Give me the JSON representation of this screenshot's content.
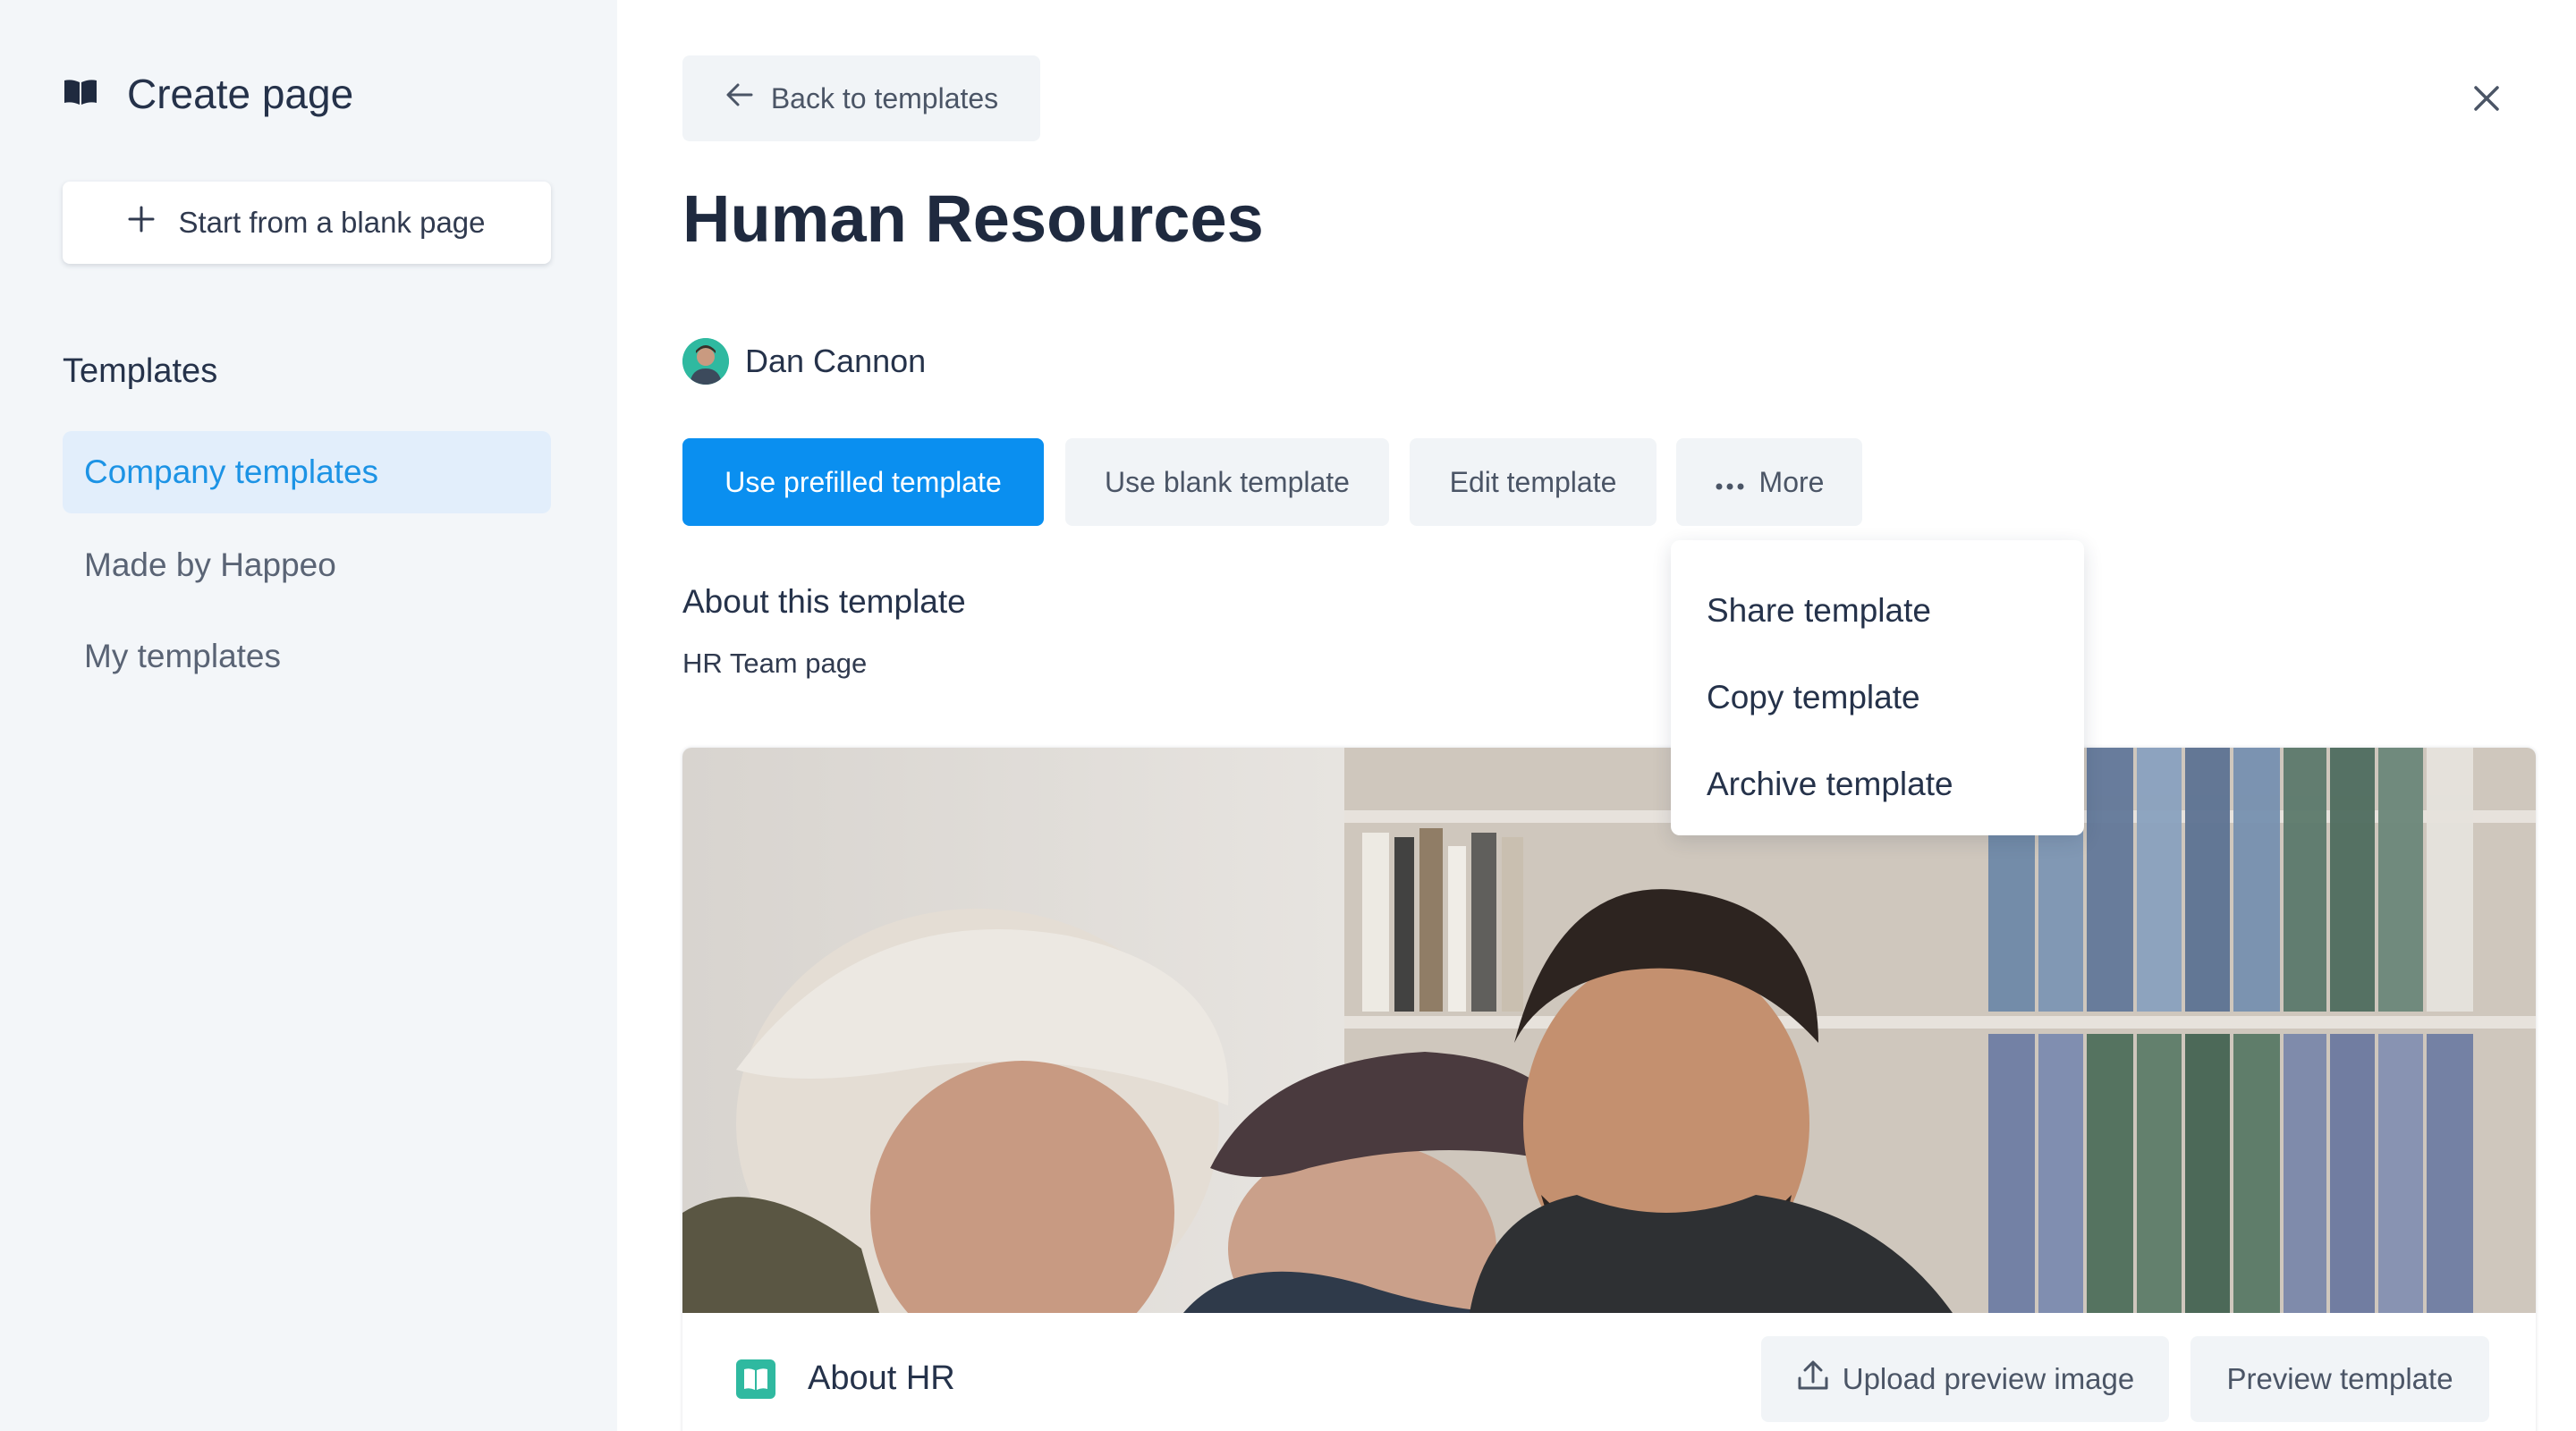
{
  "sidebar": {
    "title": "Create page",
    "blank_button": "Start from a blank page",
    "section_label": "Templates",
    "items": [
      {
        "label": "Company templates",
        "active": true
      },
      {
        "label": "Made by Happeo",
        "active": false
      },
      {
        "label": "My templates",
        "active": false
      }
    ]
  },
  "main": {
    "back_label": "Back to templates",
    "title": "Human Resources",
    "author": "Dan Cannon",
    "actions": {
      "prefilled": "Use prefilled template",
      "blank": "Use blank template",
      "edit": "Edit template",
      "more": "More"
    },
    "more_menu": [
      "Share template",
      "Copy template",
      "Archive template"
    ],
    "about_heading": "About this template",
    "about_description": "HR Team page",
    "card": {
      "title": "About HR",
      "upload_label": "Upload preview image",
      "preview_label": "Preview template"
    }
  },
  "colors": {
    "accent": "#0a8ff0",
    "active_item_bg": "#e2eefb",
    "active_item_text": "#1c93e5",
    "sidebar_bg": "#f3f6f9",
    "icon_teal": "#2fb9a0"
  }
}
